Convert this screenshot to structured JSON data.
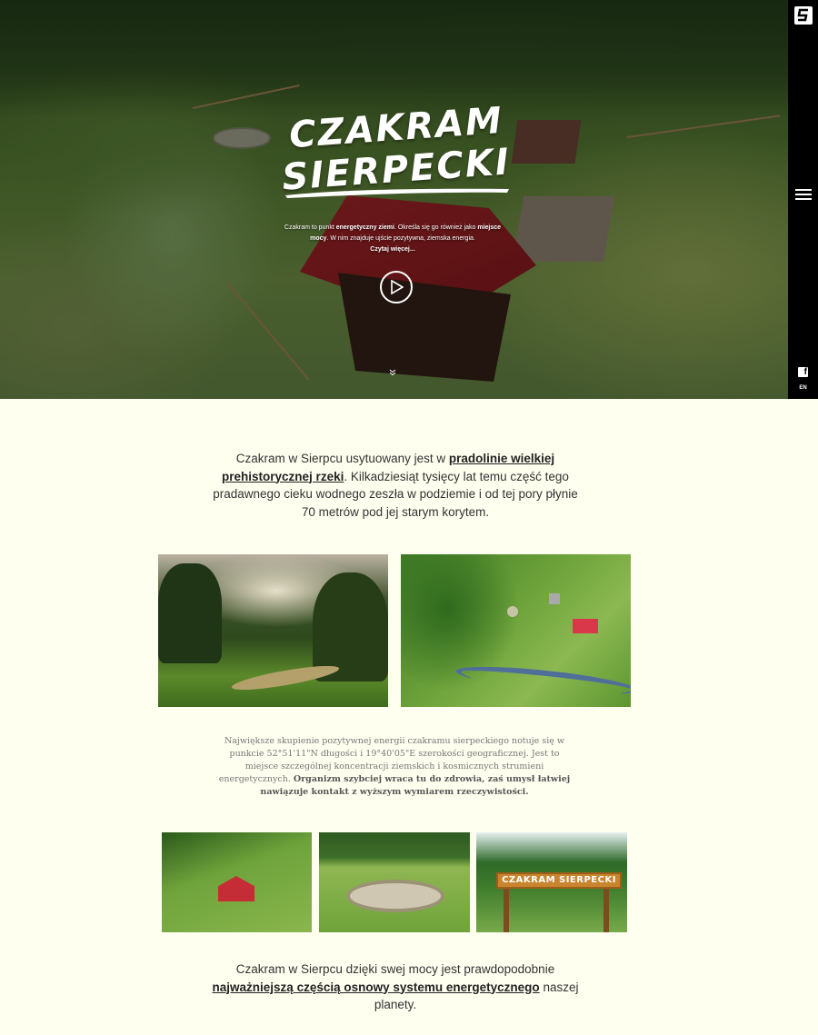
{
  "hero": {
    "title_line1": "CZAKRAM",
    "title_line2": "SIERPECKI",
    "intro_part1": "Czakram to punkt ",
    "intro_bold1": "energetyczny ziemi",
    "intro_part2": ". Określa się go również jako ",
    "intro_bold2": "miejsce mocy",
    "intro_part3": ". W nim znajduje ujście pozytywna, ziemska energia.",
    "read_more": "Czytaj więcej...",
    "play_icon": "play-circle-icon",
    "scroll_icon": "chevron-double-down-icon"
  },
  "sidebar": {
    "brand_icon": "site-logo-icon",
    "menu_icon": "hamburger-menu-icon",
    "facebook_icon": "facebook-icon",
    "facebook_glyph": "f",
    "language": "EN"
  },
  "section1": {
    "text1": "Czakram w Sierpcu usytuowany jest w ",
    "link": "pradolinie wielkiej prehistorycznej rzeki",
    "text2": ". Kilkadziesiąt tysięcy lat temu część tego pradawnego cieku wodnego zeszła w podziemie i od tej pory płynie 70 metrów pod jej starym korytem."
  },
  "section2": {
    "text": "Największe skupienie pozytywnej energii czakramu sierpeckiego notuje się w punkcie 52°51'11\"N długości i 19°40'05\"E szerokości geograficznej. Jest to miejsce szczególnej koncentracji ziemskich i kosmicznych strumieni energetycznych. ",
    "bold": "Organizm szybciej wraca tu do zdrowia, zaś umysł łatwiej nawiązuje kontakt z wyższym wymiarem rzeczywistości."
  },
  "gallery": {
    "sign_text": "CZAKRAM SIERPECKI"
  },
  "section3": {
    "text1": "Czakram w Sierpcu dzięki swej mocy jest prawdopodobnie ",
    "link": "najważniejszą częścią osnowy systemu energetycznego",
    "text2": " naszej planety."
  },
  "colors": {
    "background": "#fffff0",
    "sidebar": "#000000",
    "roof": "#8a1f22"
  }
}
